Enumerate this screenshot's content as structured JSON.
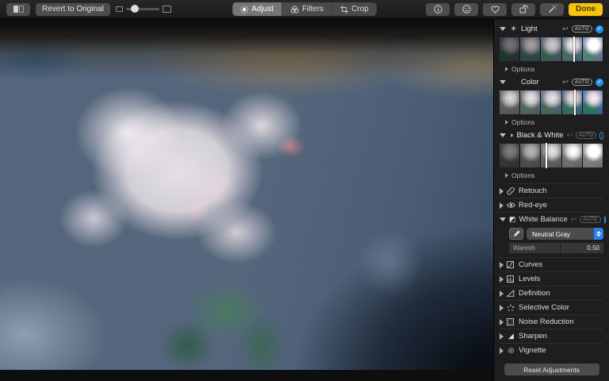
{
  "toolbar": {
    "revert_label": "Revert to Original",
    "tabs": [
      {
        "label": "Adjust"
      },
      {
        "label": "Filters"
      },
      {
        "label": "Crop"
      }
    ],
    "done_label": "Done"
  },
  "sidebar": {
    "auto_label": "AUTO",
    "options_label": "Options",
    "sections": {
      "light": {
        "label": "Light",
        "checked": true
      },
      "color": {
        "label": "Color",
        "checked": true
      },
      "bw": {
        "label": "Black & White",
        "checked": false
      }
    },
    "tools": [
      {
        "label": "Retouch"
      },
      {
        "label": "Red-eye"
      }
    ],
    "white_balance": {
      "label": "White Balance",
      "checked": false,
      "mode": "Neutral Gray",
      "warmth_label": "Warmth",
      "warmth_value": "0.50"
    },
    "collapsed": [
      {
        "label": "Curves"
      },
      {
        "label": "Levels"
      },
      {
        "label": "Definition"
      },
      {
        "label": "Selective Color"
      },
      {
        "label": "Noise Reduction"
      },
      {
        "label": "Sharpen"
      },
      {
        "label": "Vignette"
      }
    ],
    "reset_label": "Reset Adjustments"
  }
}
